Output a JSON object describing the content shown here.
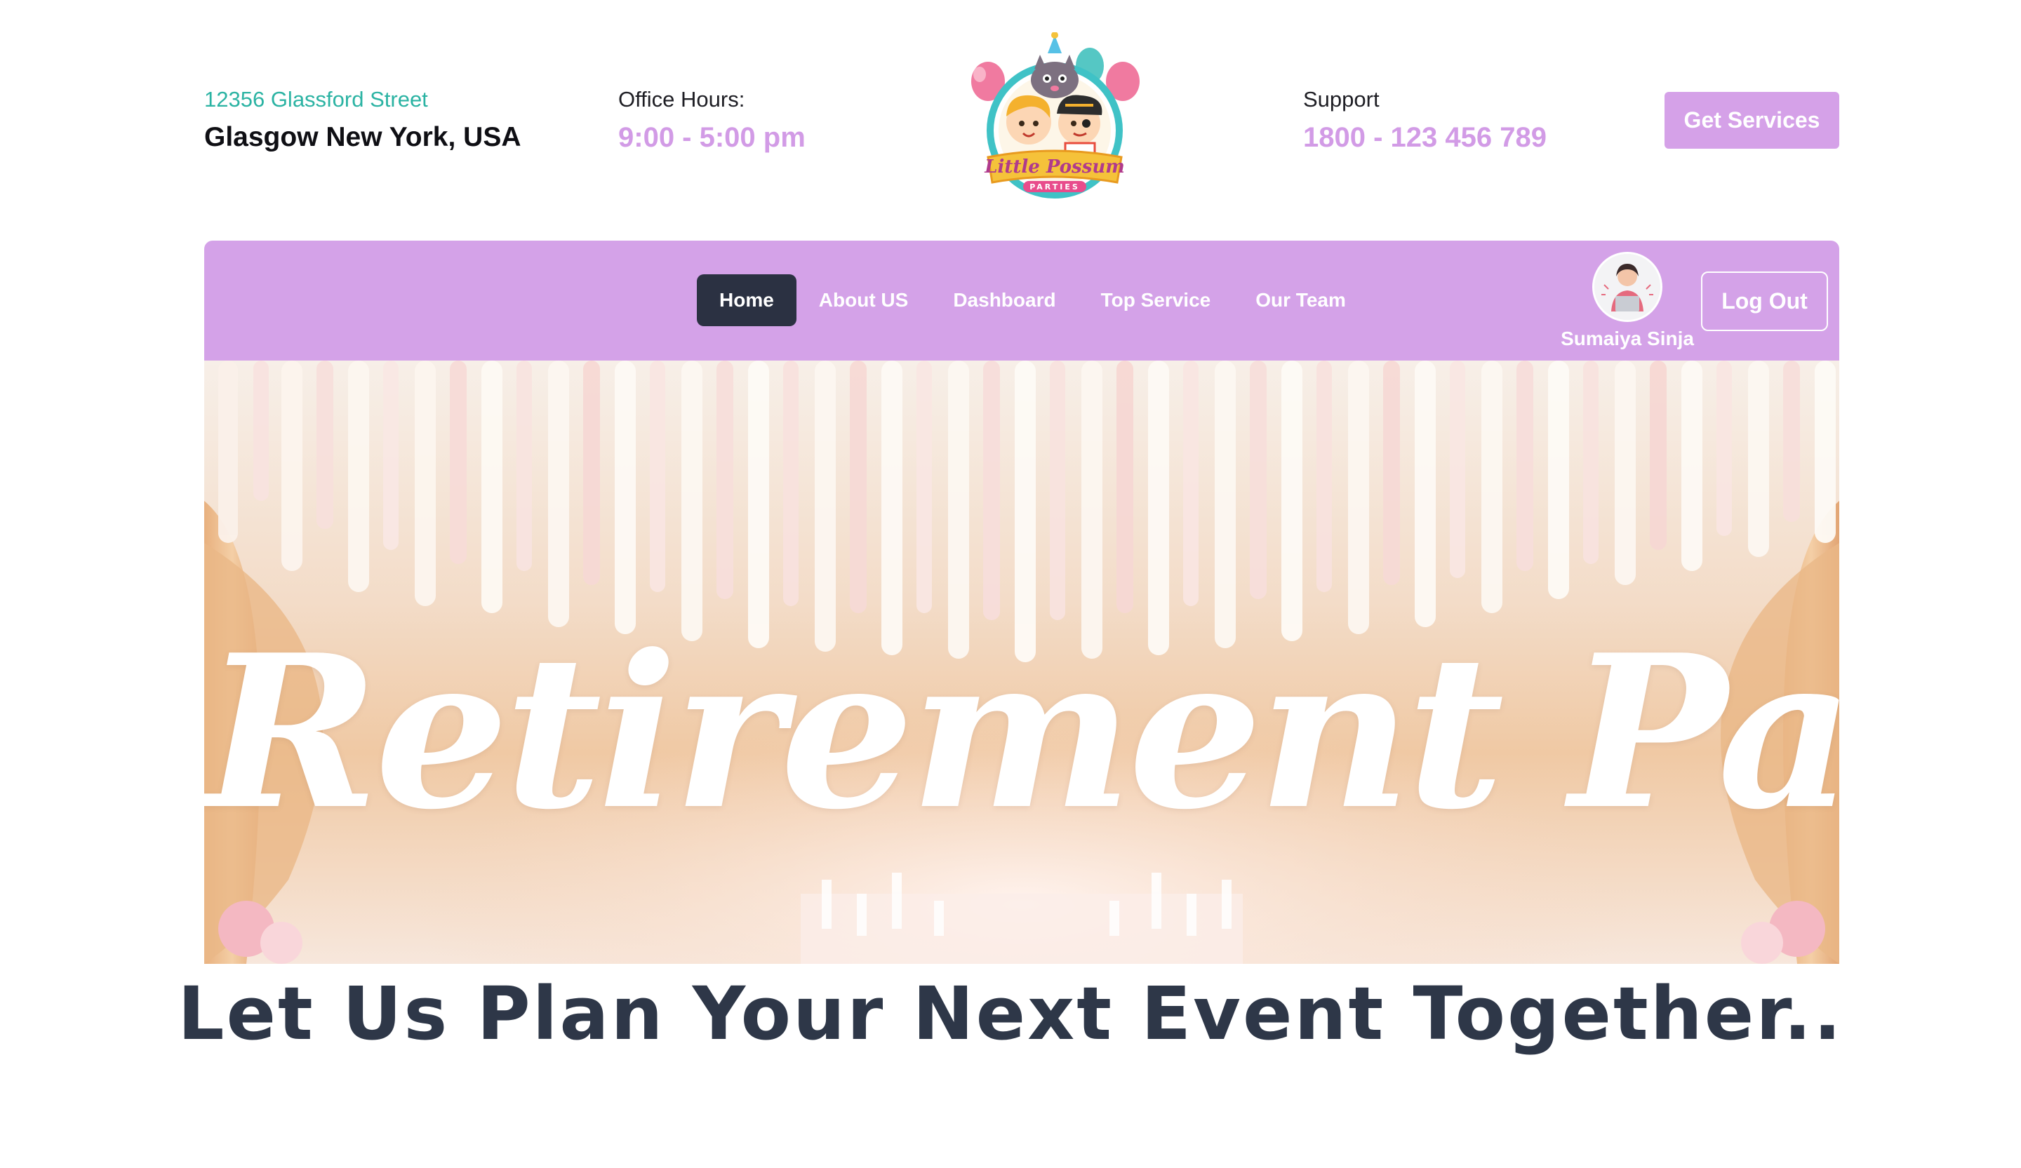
{
  "header": {
    "address_line1": "12356 Glassford Street",
    "address_line2": "Glasgow New York, USA",
    "hours_label": "Office Hours:",
    "hours_value": "9:00 - 5:00 pm",
    "logo_text": "Little Possum",
    "logo_subtext": "PARTIES",
    "support_label": "Support",
    "support_value": "1800 - 123 456 789",
    "cta_label": "Get Services"
  },
  "nav": {
    "items": [
      {
        "label": "Home",
        "active": true
      },
      {
        "label": "About US",
        "active": false
      },
      {
        "label": "Dashboard",
        "active": false
      },
      {
        "label": "Top Service",
        "active": false
      },
      {
        "label": "Our Team",
        "active": false
      }
    ],
    "user_name": "Sumaiya Sinja",
    "logout_label": "Log Out"
  },
  "hero": {
    "title": "Retirement Parties"
  },
  "tagline": "Let Us Plan Your Next Event Together..",
  "colors": {
    "accent": "#d4a2e8",
    "active_nav": "#2b3142",
    "teal": "#2bb3a3",
    "heading": "#2e3748"
  }
}
